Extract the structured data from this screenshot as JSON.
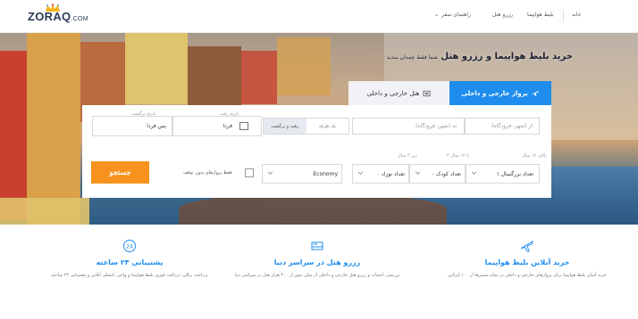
{
  "brand": {
    "logo_main": "ZORAQ",
    "logo_suffix": ".COM"
  },
  "nav": {
    "home": "خانه",
    "flight": "بلیط هواپیما",
    "hotel": "رزرو هتل",
    "travel_guide": "راهنمای سفر"
  },
  "hero": {
    "title": "خرید بلیط هواپیما و رزرو هتل",
    "subtitle": "شما فقط چمدان ببندید"
  },
  "tabs": {
    "flight": "پرواز خارجی و داخلی",
    "hotel": "هتل خارجی و داخلی"
  },
  "search": {
    "origin_placeholder": "از (شهر، فرودگاه)",
    "destination_placeholder": "به (شهر، فرودگاه)",
    "trip_one_way": "یک طرفه",
    "trip_round": "رفت و برگشت",
    "depart_label": "تاریخ رفت",
    "depart_value": "فردا",
    "return_label": "تاریخ برگشت",
    "return_value": "پس فردا",
    "adult_label": "بالای ۱۲ سال",
    "adult_value": "تعداد بزرگسال ۱",
    "child_label": "۲ تا ۱۲ سال",
    "child_value": "تعداد کودک ۰",
    "infant_label": "زیر ۲ سال",
    "infant_value": "تعداد نوزاد ۰",
    "cabin_value": "Economy",
    "nonstop_label": "فقط پروازهای بدون توقف",
    "submit_label": "جستجو"
  },
  "features": [
    {
      "title": "خرید آنلاین بلیط هواپیما",
      "desc": "خرید آسان بلیط هواپیما برای پروازهای خارجی و داخلی در تمام مسیرها از ۱۰۰ ایرلاین",
      "icon": "plane-icon"
    },
    {
      "title": "رزرو هتل در سراسر دنیا",
      "desc": "بررسی، انتخاب و رزرو هتل خارجی و داخلی از میان بیش از ۴۰۰ هزار هتل در سراسر دنیا",
      "icon": "hotel-bed-icon"
    },
    {
      "title": "پشتیبانی ۲۴ ساعته",
      "desc": "پرداخت ریالی، دریافت فوری بلیط هواپیما و واچر، کنسلی آنلاین و پشتیبانی ۲۴ ساعته",
      "icon": "support-24-icon"
    }
  ],
  "colors": {
    "accent": "#1f8ded",
    "orange": "#f7921e",
    "navy": "#2b3a57"
  }
}
